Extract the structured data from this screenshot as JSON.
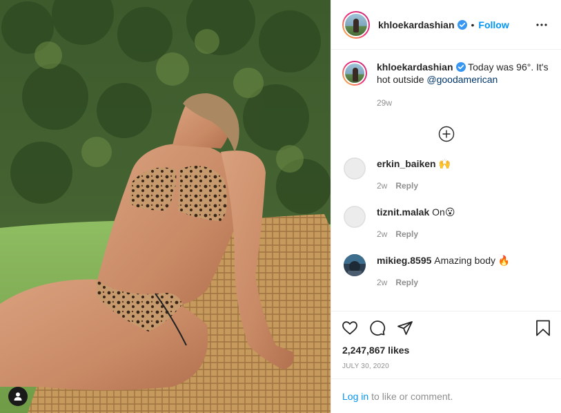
{
  "post": {
    "username": "khloekardashian",
    "follow_label": "Follow",
    "separator": "•",
    "caption": {
      "username": "khloekardashian",
      "text": "Today was 96°. It's hot outside ",
      "mention": "@goodamerican",
      "time": "29w"
    },
    "comments": [
      {
        "username": "erkin_baiken",
        "text": "🙌",
        "time": "2w",
        "reply_label": "Reply"
      },
      {
        "username": "tiznit.malak",
        "text": "On😮",
        "time": "2w",
        "reply_label": "Reply"
      },
      {
        "username": "mikieg.8595",
        "text": "Amazing body 🔥",
        "time": "2w",
        "reply_label": "Reply"
      }
    ],
    "likes": "2,247,867 likes",
    "date": "JULY 30, 2020",
    "login_link": "Log in",
    "login_suffix": "to like or comment."
  },
  "icons": {
    "verified": "verified-badge-icon",
    "more": "more-options-icon",
    "load_more": "plus-circle-icon",
    "like": "heart-icon",
    "comment": "comment-bubble-icon",
    "share": "paper-plane-icon",
    "save": "bookmark-icon",
    "user_tags": "user-tag-icon"
  },
  "colors": {
    "link": "#0095f6",
    "mention": "#00376b",
    "muted": "#8e8e8e",
    "text": "#262626"
  }
}
